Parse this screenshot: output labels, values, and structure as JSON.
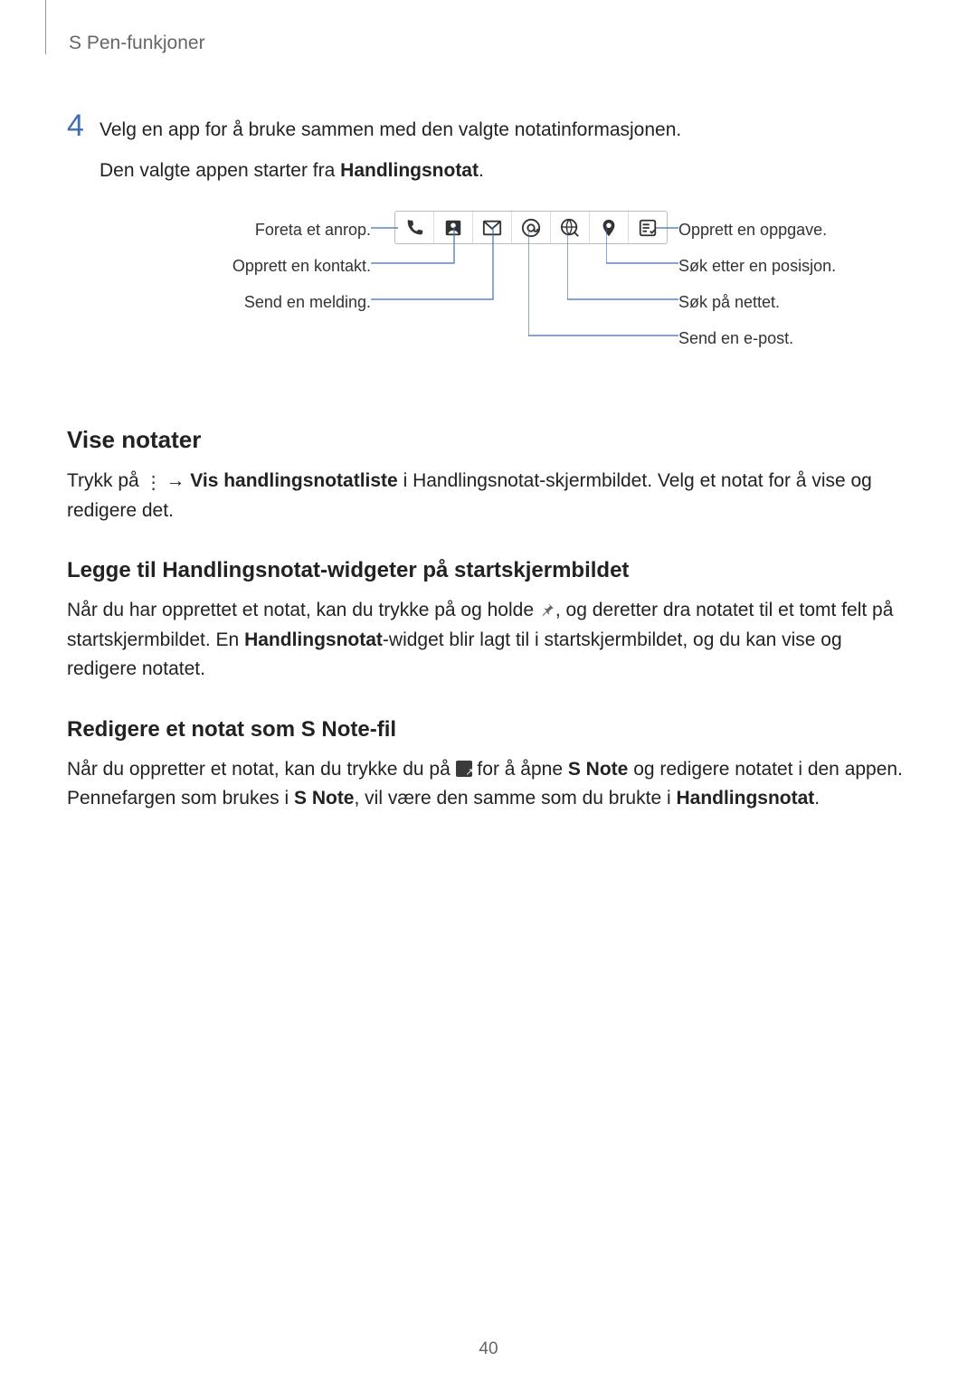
{
  "header": {
    "title": "S Pen-funkjoner"
  },
  "step4": {
    "num": "4",
    "line1": "Velg en app for å bruke sammen med den valgte notatinformasjonen.",
    "line2_pre": "Den valgte appen starter fra ",
    "line2_bold": "Handlingsnotat",
    "line2_post": "."
  },
  "figure": {
    "left": {
      "call": "Foreta et anrop.",
      "contact": "Opprett en kontakt.",
      "message": "Send en melding."
    },
    "right": {
      "task": "Opprett en oppgave.",
      "location": "Søk etter en posisjon.",
      "web": "Søk på nettet.",
      "email": "Send en e-post."
    }
  },
  "sec_view": {
    "h": "Vise notater",
    "p_pre": "Trykk på ",
    "p_arrow": " → ",
    "p_bold": "Vis handlingsnotatliste",
    "p_mid": " i Handlingsnotat-skjermbildet. Velg et notat for å vise og redigere det."
  },
  "sec_widget": {
    "h": "Legge til Handlingsnotat-widgeter på startskjermbildet",
    "p_pre": "Når du har opprettet et notat, kan du trykke på og holde ",
    "p_mid1": ", og deretter dra notatet til et tomt felt på startskjermbildet. En ",
    "p_bold": "Handlingsnotat",
    "p_mid2": "-widget blir lagt til i startskjermbildet, og du kan vise og redigere notatet."
  },
  "sec_edit": {
    "h": "Redigere et notat som S Note-fil",
    "p_pre": "Når du oppretter et notat, kan du trykke du på ",
    "p_mid1": " for å åpne ",
    "p_bold1": "S Note",
    "p_mid2": " og redigere notatet i den appen. Pennefargen som brukes i ",
    "p_bold2": "S Note",
    "p_mid3": ", vil være den samme som du brukte i ",
    "p_bold3": "Handlingsnotat",
    "p_post": "."
  },
  "page_number": "40"
}
